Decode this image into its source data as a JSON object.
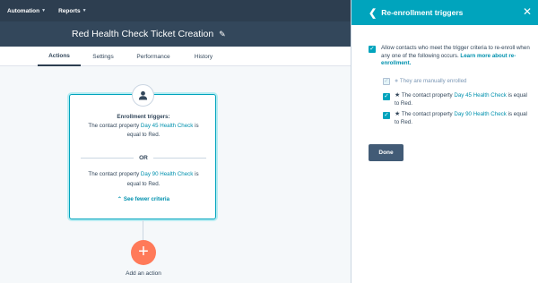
{
  "topnav": {
    "items": [
      {
        "label": "Automation"
      },
      {
        "label": "Reports"
      }
    ]
  },
  "workflow": {
    "title": "Red Health Check Ticket Creation"
  },
  "tabs": [
    {
      "label": "Actions",
      "active": true
    },
    {
      "label": "Settings",
      "active": false
    },
    {
      "label": "Performance",
      "active": false
    },
    {
      "label": "History",
      "active": false
    }
  ],
  "trigger_card": {
    "heading": "Enrollment triggers:",
    "criteria": [
      {
        "prefix": "The contact property",
        "property": "Day 45 Health Check",
        "suffix_is": "is",
        "condition": "equal to Red."
      },
      {
        "prefix": "The contact property",
        "property": "Day 90 Health Check",
        "suffix_is": "is",
        "condition": "equal to Red."
      }
    ],
    "or_label": "OR",
    "see_fewer": "See fewer criteria"
  },
  "add_action": {
    "label": "Add an action"
  },
  "panel": {
    "title": "Re-enrollment triggers",
    "allow": {
      "checked": true,
      "text": "Allow contacts who meet the trigger criteria to re-enroll when any one of the following occurs.",
      "link": "Learn more about re-enrollment."
    },
    "options": [
      {
        "type": "manual",
        "checked": true,
        "disabled": true,
        "text": "They are manually enrolled"
      },
      {
        "type": "property",
        "checked": true,
        "prefix": "The contact property",
        "property": "Day 45 Health Check",
        "suffix": "is equal to Red."
      },
      {
        "type": "property",
        "checked": true,
        "prefix": "The contact property",
        "property": "Day 90 Health Check",
        "suffix": "is equal to Red."
      }
    ],
    "done_label": "Done"
  },
  "icons": {
    "pencil": "pencil-icon",
    "user": "user-icon",
    "plus": "plus-icon",
    "back": "chevron-left-icon",
    "close": "close-icon",
    "star": "star-icon"
  },
  "colors": {
    "nav_dark": "#2d3e50",
    "title_bar": "#33475b",
    "accent_teal": "#00a4bd",
    "link": "#0091ae",
    "add_orange": "#ff7a59",
    "done_button": "#425b76"
  }
}
